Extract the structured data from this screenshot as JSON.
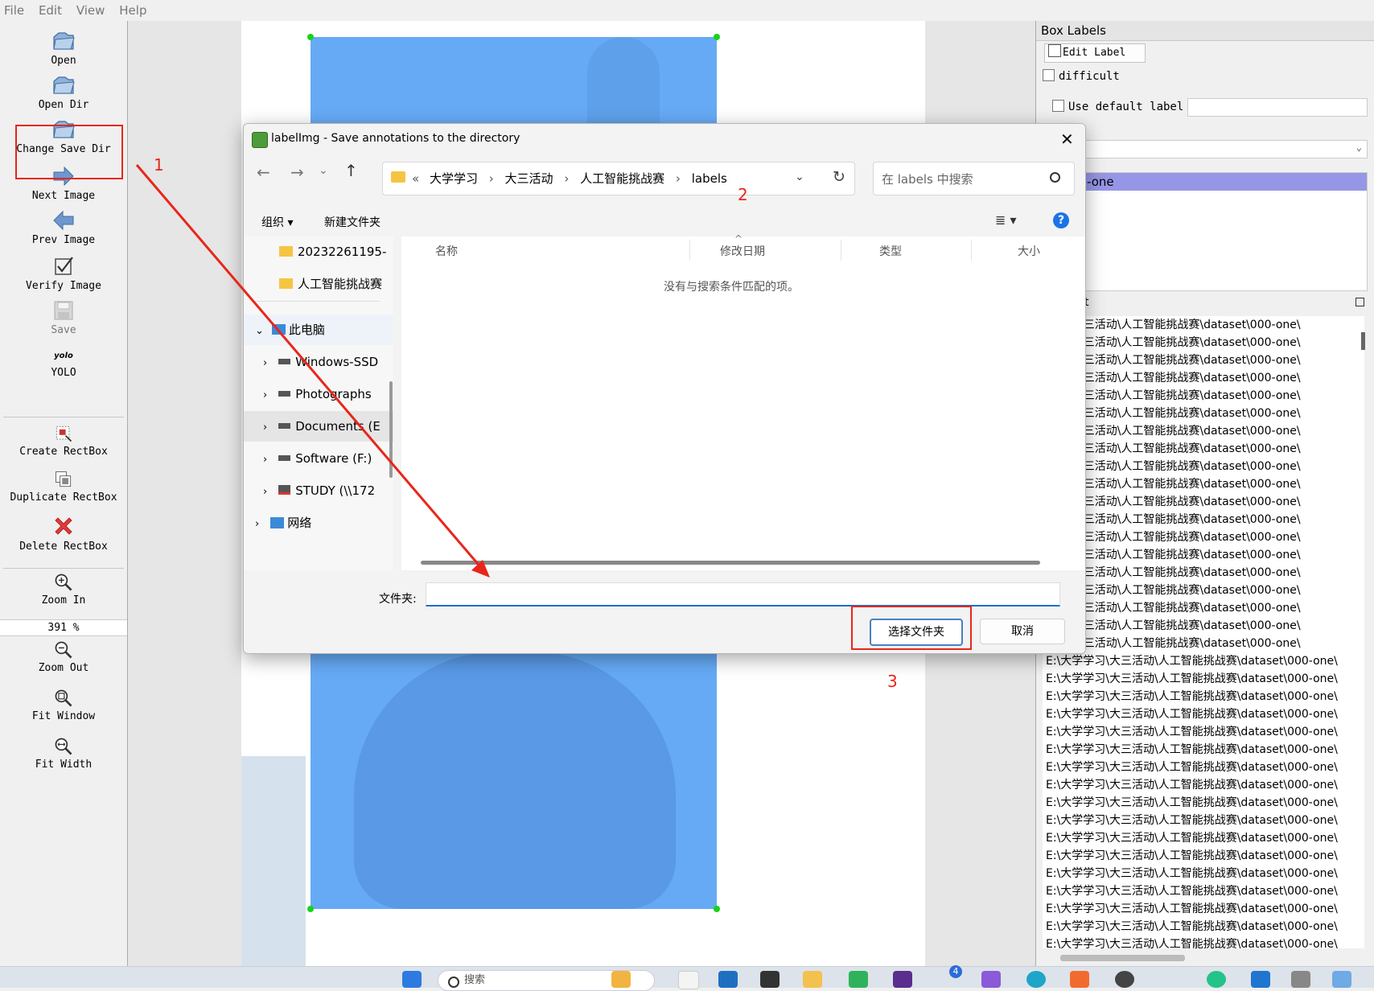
{
  "menu": {
    "file": "File",
    "edit": "Edit",
    "view": "View",
    "help": "Help"
  },
  "toolbar": {
    "open": "Open",
    "open_dir": "Open Dir",
    "change_save_dir": "Change Save Dir",
    "next_image": "Next Image",
    "prev_image": "Prev Image",
    "verify_image": "Verify Image",
    "save": "Save",
    "yolo_icon_text": "yolo",
    "yolo": "YOLO",
    "create_rectbox": "Create RectBox",
    "duplicate_rectbox": "Duplicate RectBox",
    "delete_rectbox": "Delete RectBox",
    "zoom_in": "Zoom In",
    "zoom_value": "391 %",
    "zoom_out": "Zoom Out",
    "fit_window": "Fit Window",
    "fit_width": "Fit Width"
  },
  "dock": {
    "title": "Box Labels",
    "edit_label": "Edit Label",
    "difficult": "difficult",
    "use_default_label": "Use default label",
    "label_item": "-one",
    "file_list_title": "t"
  },
  "file_list": {
    "partial_item": "学习\\大三活动\\人工智能挑战赛\\dataset\\000-one\\",
    "full_item": "E:\\大学学习\\大三活动\\人工智能挑战赛\\dataset\\000-one\\",
    "last_item": "E:\\大学学习\\大三活动\\人工智能挑战赛\\dataset\\000-one\\",
    "partial_count": 19,
    "full_count": 16
  },
  "dialog": {
    "title": "labelImg - Save annotations to the directory",
    "breadcrumb": [
      "«",
      "大学学习",
      "大三活动",
      "人工智能挑战赛",
      "labels"
    ],
    "search_placeholder": "在 labels 中搜索",
    "organize": "组织 ▾",
    "new_folder": "新建文件夹",
    "nav_items": [
      "20232261195-",
      "人工智能挑战赛",
      "此电脑",
      "Windows-SSD",
      "Photographs",
      "Documents (E",
      "Software (F:)",
      "STUDY (\\\\172",
      "网络"
    ],
    "columns": {
      "name": "名称",
      "date": "修改日期",
      "type": "类型",
      "size": "大小"
    },
    "empty_message": "没有与搜索条件匹配的项。",
    "folder_label": "文件夹:",
    "folder_value": "",
    "select_button": "选择文件夹",
    "cancel_button": "取消"
  },
  "annotations": {
    "one": "1",
    "two": "2",
    "three": "3"
  },
  "taskbar": {
    "search_placeholder": "搜索",
    "badge": "4"
  },
  "colors": {
    "bbox": "#66aaf5",
    "highlight": "#e8261a",
    "accent": "#4a7fc4",
    "selected_label": "#9696e6"
  }
}
